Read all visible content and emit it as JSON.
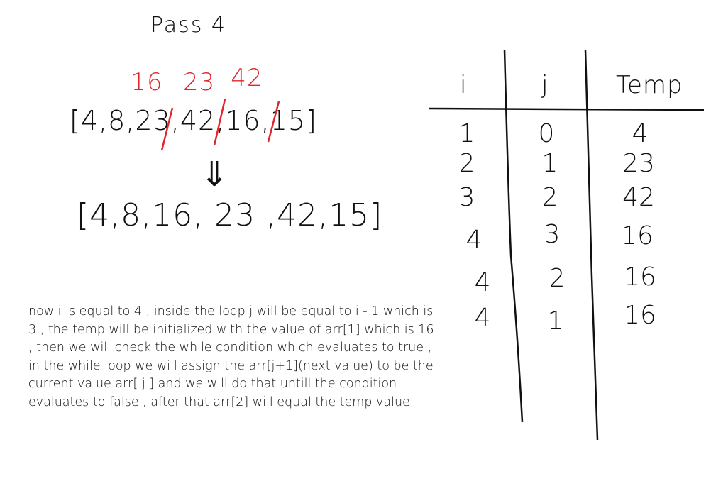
{
  "title": "Pass 4",
  "array_before": {
    "open": "[",
    "items": [
      "4",
      "8",
      "23",
      "42",
      "16",
      "15"
    ],
    "close": "]",
    "corrections": [
      "16",
      "23",
      "42"
    ]
  },
  "arrow": "⇓",
  "array_after": {
    "open": "[",
    "items": [
      "4",
      "8",
      "16",
      "23",
      "42",
      "15"
    ],
    "close": "]"
  },
  "explanation": "now i is equal to 4 , inside the loop j will be equal to i - 1 which is 3 , the temp will be initialized with the value of arr[1] which is 16 , then we will check the while condition which evaluates to true , in the while loop we will assign the arr[j+1](next value) to be the current value arr[ j ] and we will do that untill the condition evaluates to false , after that arr[2]  will equal the temp value",
  "table": {
    "headers": [
      "i",
      "j",
      "Temp"
    ],
    "rows": [
      [
        "1",
        "0",
        "4"
      ],
      [
        "2",
        "1",
        "23"
      ],
      [
        "3",
        "2",
        "42"
      ],
      [
        "4",
        "3",
        "16"
      ],
      [
        "4",
        "2",
        "16"
      ],
      [
        "4",
        "1",
        "16"
      ]
    ]
  },
  "colors": {
    "ink": "#111111",
    "correction": "#e0252c"
  }
}
